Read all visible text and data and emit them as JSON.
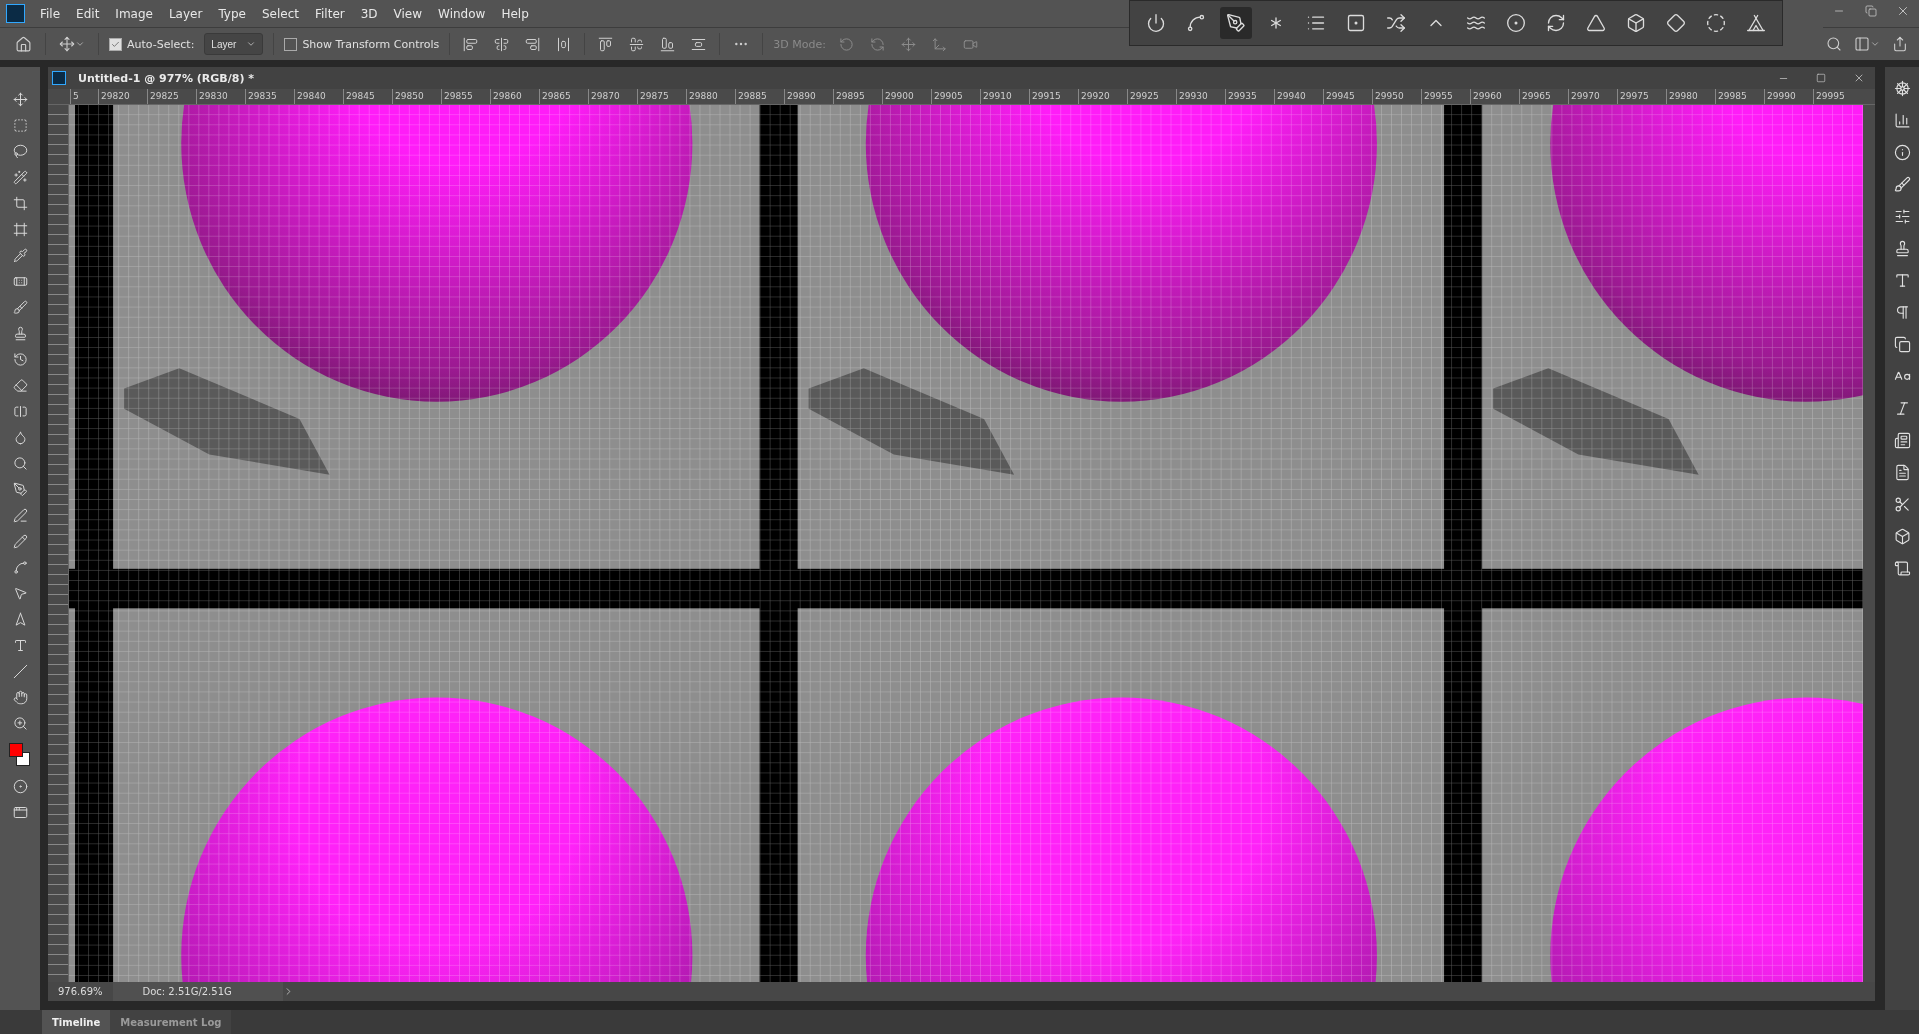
{
  "menu": [
    "File",
    "Edit",
    "Image",
    "Layer",
    "Type",
    "Select",
    "Filter",
    "3D",
    "View",
    "Window",
    "Help"
  ],
  "options_bar": {
    "auto_select": {
      "label": "Auto-Select:",
      "checked": true
    },
    "target": "Layer",
    "show_transform": {
      "label": "Show Transform Controls",
      "checked": false
    },
    "mode_label": "3D Mode:"
  },
  "document": {
    "title": "Untitled-1 @ 977% (RGB/8) *",
    "ruler": [
      "5",
      "29820",
      "29825",
      "29830",
      "29835",
      "29840",
      "29845",
      "29850",
      "29855",
      "29860",
      "29865",
      "29870",
      "29875",
      "29880",
      "29885",
      "29890",
      "29895",
      "29900",
      "29905",
      "29910",
      "29915",
      "29920",
      "29925",
      "29930",
      "29935",
      "29940",
      "29945",
      "29950",
      "29955",
      "29960",
      "29965",
      "29970",
      "29975",
      "29980",
      "29985",
      "29990",
      "29995"
    ],
    "zoom": "976.69%",
    "doc_size": "Doc: 2.51G/2.51G"
  },
  "panel_tabs": [
    {
      "label": "Timeline",
      "selected": true
    },
    {
      "label": "Measurement Log",
      "selected": false
    }
  ]
}
